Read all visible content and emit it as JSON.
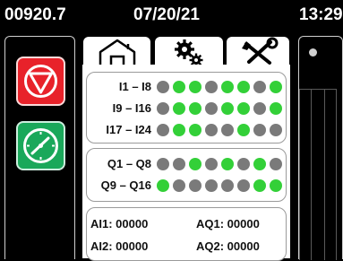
{
  "status": {
    "counter": "00920.7",
    "date": "07/20/21",
    "time": "13:29"
  },
  "tabs": [
    {
      "icon": "home-icon"
    },
    {
      "icon": "gears-icon"
    },
    {
      "icon": "tools-icon"
    }
  ],
  "left_buttons": [
    {
      "icon": "stop-icon",
      "color": "#e8222a"
    },
    {
      "icon": "gauge-icon",
      "color": "#1aa85a"
    }
  ],
  "colors": {
    "on": "#33d038",
    "off": "#7a7a7a"
  },
  "inputs": [
    {
      "label": "I1 – I8",
      "states": [
        0,
        1,
        1,
        0,
        1,
        1,
        0,
        1
      ]
    },
    {
      "label": "I9 – I16",
      "states": [
        0,
        1,
        1,
        0,
        1,
        1,
        0,
        1
      ]
    },
    {
      "label": "I17 – I24",
      "states": [
        0,
        1,
        1,
        0,
        0,
        1,
        0,
        0
      ]
    }
  ],
  "outputs": [
    {
      "label": "Q1 – Q8",
      "states": [
        0,
        0,
        1,
        0,
        1,
        0,
        1,
        0
      ]
    },
    {
      "label": "Q9 – Q16",
      "states": [
        1,
        0,
        0,
        0,
        0,
        0,
        1,
        1
      ]
    }
  ],
  "analog": {
    "ai1": "AI1: 00000",
    "aq1": "AQ1: 00000",
    "ai2": "AI2: 00000",
    "aq2": "AQ2: 00000"
  }
}
